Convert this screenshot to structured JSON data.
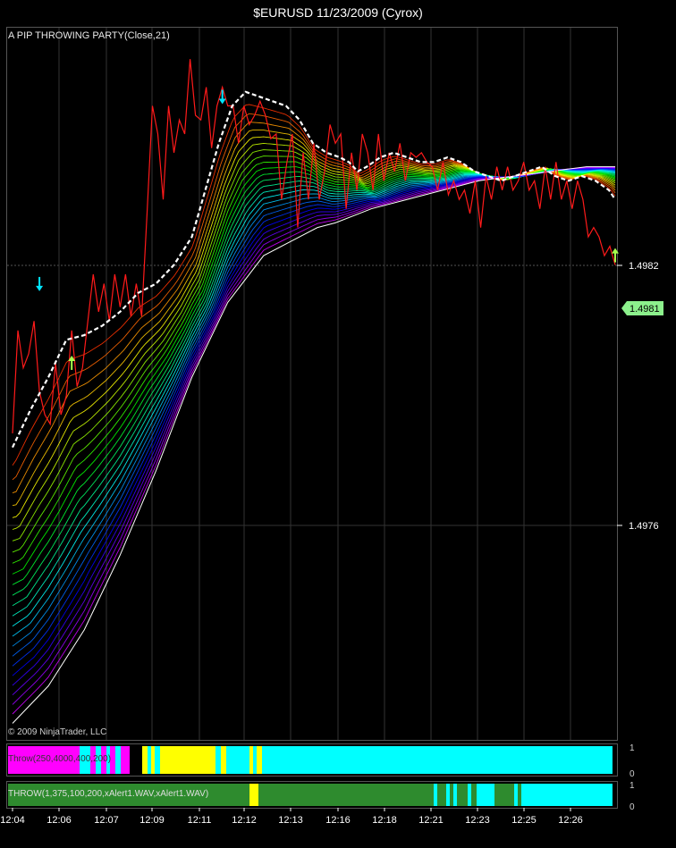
{
  "chart_data": {
    "type": "line",
    "title": "$EURUSD  11/23/2009 (Cyrox)",
    "indicator_label": "A PIP THROWING PARTY(Close,21)",
    "copyright": "© 2009 NinjaTrader, LLC",
    "x_ticks": [
      "12:04",
      "12:06",
      "12:07",
      "12:09",
      "12:11",
      "12:12",
      "12:13",
      "12:16",
      "12:18",
      "12:21",
      "12:23",
      "12:25",
      "12:26"
    ],
    "y_ticks": [
      1.4982,
      1.4976
    ],
    "ylim": [
      1.49704,
      1.49853
    ],
    "last_price_label": "1.4981",
    "last_price": 1.4981,
    "series": [
      {
        "name": "close",
        "color": "#ff1a1a",
        "x": [
          0,
          6,
          12,
          18,
          24,
          30,
          36,
          42,
          48,
          54,
          60,
          66,
          72,
          78,
          84,
          90,
          96,
          102,
          108,
          114,
          120,
          126,
          132,
          138,
          144,
          150,
          156,
          162,
          168,
          174,
          180,
          186,
          192,
          198,
          204,
          210,
          216,
          222,
          228,
          234,
          240,
          246,
          252,
          258,
          264,
          270,
          276,
          282,
          288,
          294,
          300,
          306,
          312,
          318,
          324,
          330,
          336,
          342,
          348,
          354,
          360,
          366,
          372,
          378,
          384,
          390,
          396,
          402,
          408,
          414,
          420,
          426,
          432,
          438,
          444,
          450,
          456,
          462,
          468,
          474,
          480,
          486,
          492,
          498,
          504,
          510,
          516,
          522,
          528,
          534,
          540,
          546,
          552,
          558,
          564,
          570,
          576,
          582,
          588,
          594,
          600,
          606,
          612,
          618,
          624,
          630,
          636,
          642,
          648,
          654,
          660,
          666,
          672
        ],
        "y": [
          1.49768,
          1.4979,
          1.49782,
          1.49785,
          1.49792,
          1.49777,
          1.49772,
          1.4977,
          1.49783,
          1.49772,
          1.49776,
          1.4979,
          1.49778,
          1.49782,
          1.49792,
          1.49802,
          1.49794,
          1.498,
          1.49792,
          1.49802,
          1.49795,
          1.49802,
          1.49793,
          1.498,
          1.49793,
          1.49815,
          1.49838,
          1.49832,
          1.49818,
          1.49838,
          1.49828,
          1.49835,
          1.49832,
          1.49848,
          1.49836,
          1.49835,
          1.49842,
          1.49829,
          1.49838,
          1.49842,
          1.49838,
          1.49838,
          1.4983,
          1.49838,
          1.49834,
          1.49836,
          1.49839,
          1.49836,
          1.49831,
          1.49832,
          1.49818,
          1.49826,
          1.49832,
          1.49812,
          1.49828,
          1.49818,
          1.4983,
          1.49818,
          1.49824,
          1.49834,
          1.4983,
          1.49832,
          1.49816,
          1.49828,
          1.4982,
          1.49832,
          1.49828,
          1.4982,
          1.49832,
          1.49822,
          1.49828,
          1.49824,
          1.4983,
          1.49822,
          1.49828,
          1.49827,
          1.49828,
          1.49826,
          1.49825,
          1.4982,
          1.49826,
          1.49819,
          1.49822,
          1.49818,
          1.4982,
          1.49815,
          1.49822,
          1.49812,
          1.49823,
          1.49818,
          1.49825,
          1.4982,
          1.49825,
          1.4982,
          1.49822,
          1.49826,
          1.4982,
          1.49822,
          1.49816,
          1.49825,
          1.49818,
          1.49826,
          1.49818,
          1.49822,
          1.49816,
          1.49822,
          1.49818,
          1.4981,
          1.49812,
          1.4981,
          1.49806,
          1.49808,
          1.49804
        ]
      },
      {
        "name": "smoothed",
        "color": "#ffffff",
        "dashed": true,
        "x": [
          0,
          20,
          40,
          60,
          80,
          100,
          120,
          140,
          160,
          180,
          200,
          215,
          230,
          245,
          260,
          275,
          290,
          305,
          320,
          335,
          350,
          365,
          375,
          385,
          395,
          410,
          425,
          440,
          455,
          470,
          485,
          500,
          515,
          530,
          545,
          560,
          575,
          590,
          605,
          620,
          635,
          650,
          665,
          672
        ],
        "y": [
          1.49765,
          1.49773,
          1.4978,
          1.49788,
          1.49789,
          1.49791,
          1.49794,
          1.49798,
          1.498,
          1.49804,
          1.4981,
          1.4982,
          1.4983,
          1.49838,
          1.49841,
          1.4984,
          1.49839,
          1.49838,
          1.49835,
          1.4983,
          1.49828,
          1.49827,
          1.49826,
          1.49824,
          1.49825,
          1.49827,
          1.49828,
          1.49827,
          1.49826,
          1.49826,
          1.49827,
          1.49826,
          1.49824,
          1.49823,
          1.49822,
          1.49823,
          1.49824,
          1.49825,
          1.49823,
          1.49822,
          1.49823,
          1.49822,
          1.4982,
          1.49818
        ]
      },
      {
        "name": "base",
        "color": "#ffffff",
        "x": [
          0,
          40,
          80,
          120,
          160,
          200,
          240,
          280,
          320,
          340,
          360,
          400,
          440,
          480,
          520,
          560,
          600,
          640,
          672
        ],
        "y": [
          1.49706,
          1.49714,
          1.49726,
          1.49742,
          1.4976,
          1.4978,
          1.49796,
          1.49806,
          1.4981,
          1.49812,
          1.49813,
          1.49816,
          1.49818,
          1.4982,
          1.49822,
          1.49823,
          1.49824,
          1.49825,
          1.49825
        ]
      }
    ],
    "arrows": [
      {
        "x": 30,
        "y": 1.49798,
        "dir": "down",
        "color": "#00e5ff"
      },
      {
        "x": 66,
        "y": 1.49785,
        "dir": "up",
        "color": "#a6ff4d"
      },
      {
        "x": 234,
        "y": 1.49838,
        "dir": "down",
        "color": "#00e5ff"
      },
      {
        "x": 672,
        "y": 1.49808,
        "dir": "up",
        "color": "#a6ff4d"
      }
    ],
    "panels": [
      {
        "label": "Throw(250,4000,400,200)",
        "ticks": [
          "1",
          "0"
        ],
        "segments": [
          {
            "start": 0,
            "end": 80,
            "color": "#ff00ff"
          },
          {
            "start": 80,
            "end": 92,
            "color": "#00ffff"
          },
          {
            "start": 92,
            "end": 98,
            "color": "#ff00ff"
          },
          {
            "start": 98,
            "end": 104,
            "color": "#00ffff"
          },
          {
            "start": 104,
            "end": 110,
            "color": "#ff00ff"
          },
          {
            "start": 110,
            "end": 114,
            "color": "#00ffff"
          },
          {
            "start": 114,
            "end": 120,
            "color": "#ff00ff"
          },
          {
            "start": 120,
            "end": 126,
            "color": "#00ffff"
          },
          {
            "start": 126,
            "end": 136,
            "color": "#ff00ff"
          },
          {
            "start": 136,
            "end": 150,
            "color": "#000000"
          },
          {
            "start": 150,
            "end": 156,
            "color": "#ffff00"
          },
          {
            "start": 156,
            "end": 160,
            "color": "#00ffff"
          },
          {
            "start": 160,
            "end": 164,
            "color": "#ffff00"
          },
          {
            "start": 164,
            "end": 170,
            "color": "#00ffff"
          },
          {
            "start": 170,
            "end": 232,
            "color": "#ffff00"
          },
          {
            "start": 232,
            "end": 238,
            "color": "#00ffff"
          },
          {
            "start": 238,
            "end": 244,
            "color": "#ffff00"
          },
          {
            "start": 244,
            "end": 270,
            "color": "#00ffff"
          },
          {
            "start": 270,
            "end": 274,
            "color": "#ffff00"
          },
          {
            "start": 274,
            "end": 278,
            "color": "#00ffff"
          },
          {
            "start": 278,
            "end": 284,
            "color": "#ffff00"
          },
          {
            "start": 284,
            "end": 676,
            "color": "#00ffff"
          }
        ]
      },
      {
        "label": "THROW(1,375,100,200,xAlert1.WAV,xAlert1.WAV)",
        "ticks": [
          "1",
          "0"
        ],
        "segments": [
          {
            "start": 0,
            "end": 270,
            "color": "#2e8b2e"
          },
          {
            "start": 270,
            "end": 280,
            "color": "#ffff00"
          },
          {
            "start": 280,
            "end": 476,
            "color": "#2e8b2e"
          },
          {
            "start": 476,
            "end": 480,
            "color": "#00ffff"
          },
          {
            "start": 480,
            "end": 490,
            "color": "#2e8b2e"
          },
          {
            "start": 490,
            "end": 494,
            "color": "#00ffff"
          },
          {
            "start": 494,
            "end": 498,
            "color": "#2e8b2e"
          },
          {
            "start": 498,
            "end": 502,
            "color": "#00ffff"
          },
          {
            "start": 502,
            "end": 514,
            "color": "#2e8b2e"
          },
          {
            "start": 514,
            "end": 518,
            "color": "#00ffff"
          },
          {
            "start": 518,
            "end": 524,
            "color": "#2e8b2e"
          },
          {
            "start": 524,
            "end": 544,
            "color": "#00ffff"
          },
          {
            "start": 544,
            "end": 566,
            "color": "#2e8b2e"
          },
          {
            "start": 566,
            "end": 570,
            "color": "#00ffff"
          },
          {
            "start": 570,
            "end": 574,
            "color": "#2e8b2e"
          },
          {
            "start": 574,
            "end": 676,
            "color": "#00ffff"
          }
        ]
      }
    ]
  }
}
